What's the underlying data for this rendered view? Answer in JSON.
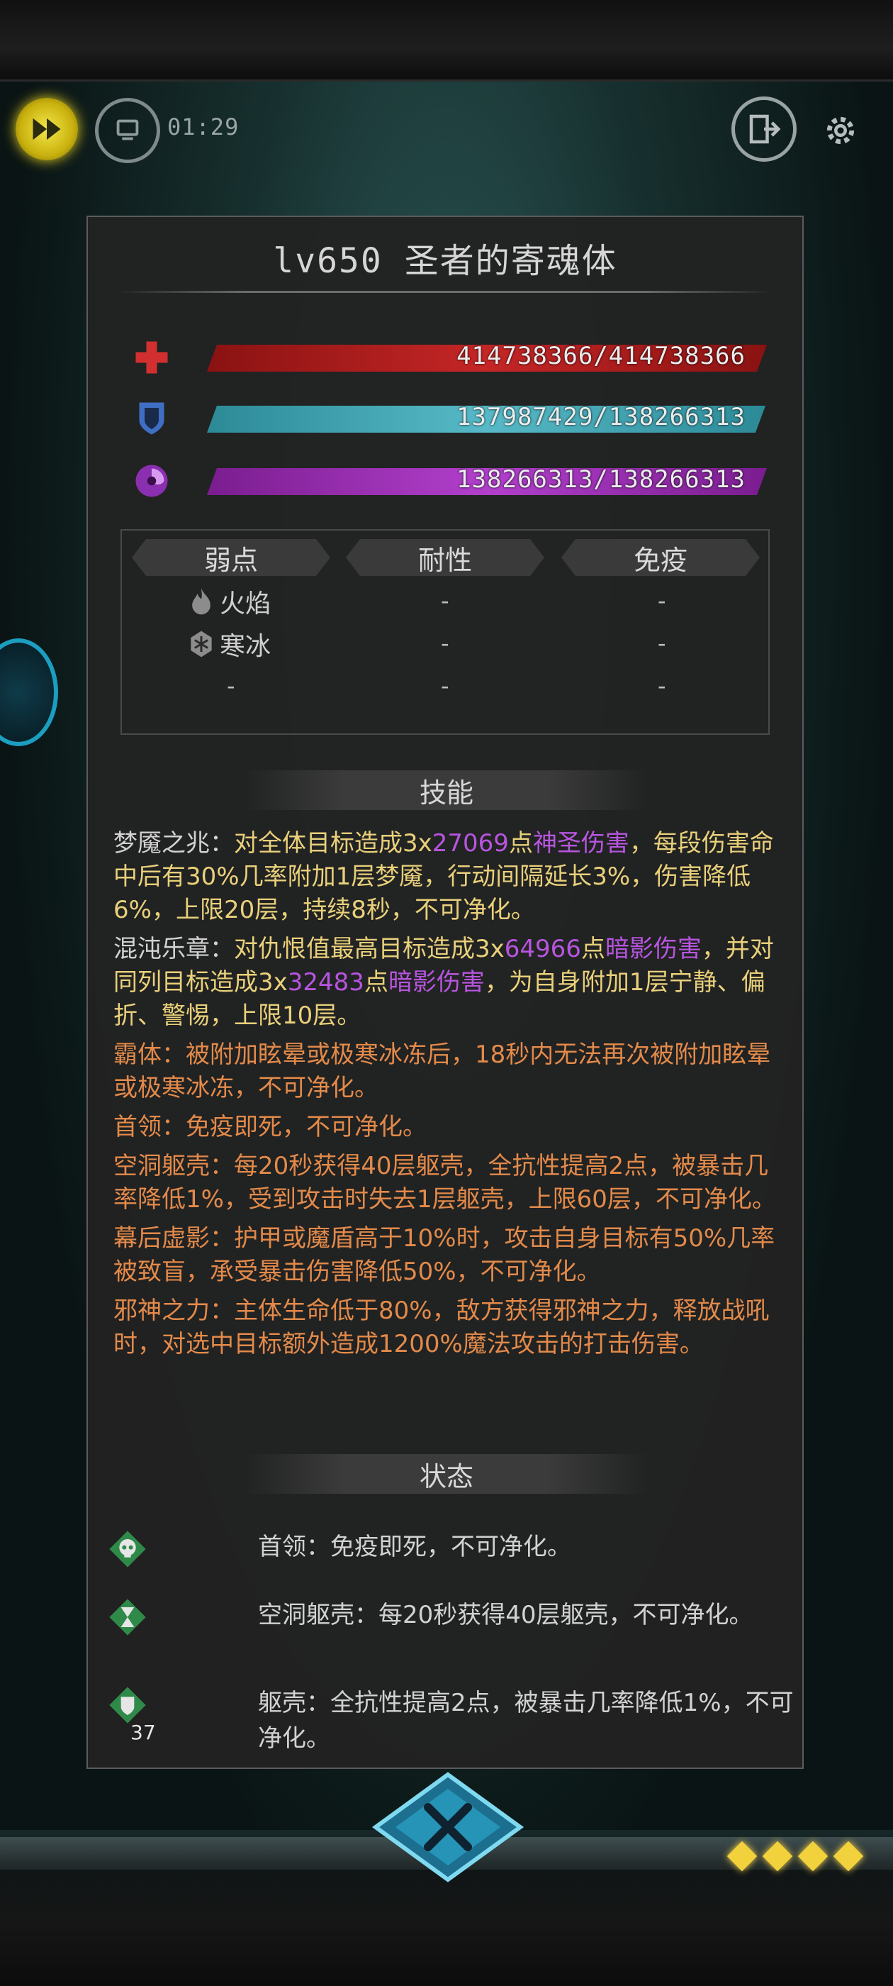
{
  "hud": {
    "timer": "01:29"
  },
  "panel": {
    "title": "lv650 圣者的寄魂体",
    "stats": [
      {
        "name": "hp",
        "text": "414738366/414738366",
        "fraction": 1.0,
        "color": "#c52626",
        "icon": "red-cross-icon"
      },
      {
        "name": "shield",
        "text": "137987429/138266313",
        "fraction": 0.998,
        "color": "#57b9c7",
        "icon": "blue-shield-icon"
      },
      {
        "name": "mana",
        "text": "138266313/138266313",
        "fraction": 1.0,
        "color": "#b23fcc",
        "icon": "purple-swirl-icon"
      }
    ],
    "resist": {
      "headers": [
        "弱点",
        "耐性",
        "免疫"
      ],
      "weak": [
        {
          "icon": "fire-icon",
          "label": "火焰"
        },
        {
          "icon": "snowflake-icon",
          "label": "寒冰"
        },
        {
          "icon": "",
          "label": "-"
        }
      ],
      "res": [
        "-",
        "-",
        "-"
      ],
      "imm": [
        "-",
        "-",
        "-"
      ]
    },
    "skills_header": "技能",
    "skills": [
      {
        "color": "yellow",
        "parts": [
          {
            "t": "梦魇之兆：",
            "c": "white"
          },
          {
            "t": "对全体目标造成3x",
            "c": "yellow"
          },
          {
            "t": "27069",
            "c": "purple"
          },
          {
            "t": "点",
            "c": "yellow"
          },
          {
            "t": "神圣伤害",
            "c": "purple"
          },
          {
            "t": "，每段伤害命中后有30%几率附加1层梦魇，行动间隔延长3%，伤害降低6%，上限20层，持续8秒，不可净化。",
            "c": "yellow"
          }
        ]
      },
      {
        "color": "yellow",
        "parts": [
          {
            "t": "混沌乐章：",
            "c": "white"
          },
          {
            "t": "对仇恨值最高目标造成3x",
            "c": "yellow"
          },
          {
            "t": "64966",
            "c": "purple"
          },
          {
            "t": "点",
            "c": "yellow"
          },
          {
            "t": "暗影伤害",
            "c": "purple"
          },
          {
            "t": "，并对同列目标造成3x",
            "c": "yellow"
          },
          {
            "t": "32483",
            "c": "purple"
          },
          {
            "t": "点",
            "c": "yellow"
          },
          {
            "t": "暗影伤害",
            "c": "purple"
          },
          {
            "t": "，为自身附加1层宁静、偏折、警惕，上限10层。",
            "c": "yellow"
          }
        ]
      },
      {
        "color": "orange",
        "parts": [
          {
            "t": "霸体：被附加眩晕或极寒冰冻后，18秒内无法再次被附加眩晕或极寒冰冻，不可净化。",
            "c": "orange"
          }
        ]
      },
      {
        "color": "orange",
        "parts": [
          {
            "t": "首领：免疫即死，不可净化。",
            "c": "orange"
          }
        ]
      },
      {
        "color": "orange",
        "parts": [
          {
            "t": "空洞躯壳：每20秒获得40层躯壳，全抗性提高2点，被暴击几率降低1%，受到攻击时失去1层躯壳，上限60层，不可净化。",
            "c": "orange"
          }
        ]
      },
      {
        "color": "orange",
        "parts": [
          {
            "t": "幕后虚影：护甲或魔盾高于10%时，攻击自身目标有50%几率被致盲，承受暴击伤害降低50%，不可净化。",
            "c": "orange"
          }
        ]
      },
      {
        "color": "orange",
        "parts": [
          {
            "t": "邪神之力：主体生命低于80%，敌方获得邪神之力，释放战吼时，对选中目标额外造成1200%魔法攻击的打击伤害。",
            "c": "orange"
          }
        ]
      }
    ],
    "status_header": "状态",
    "statuses": [
      {
        "icon": "skull-icon",
        "text": "首领：免疫即死，不可净化。",
        "count": ""
      },
      {
        "icon": "hourglass-icon",
        "text": "空洞躯壳：每20秒获得40层躯壳，不可净化。",
        "count": ""
      },
      {
        "icon": "shield-icon",
        "text": "躯壳：全抗性提高2点，被暴击几率降低1%，不可净化。",
        "count": "37"
      }
    ]
  },
  "colors": {
    "accent_yellow": "#f2d23c",
    "text_yellow": "#e9d07a",
    "text_orange": "#e38a4a",
    "text_purple": "#b855e0",
    "panel_bg": "#222222"
  }
}
